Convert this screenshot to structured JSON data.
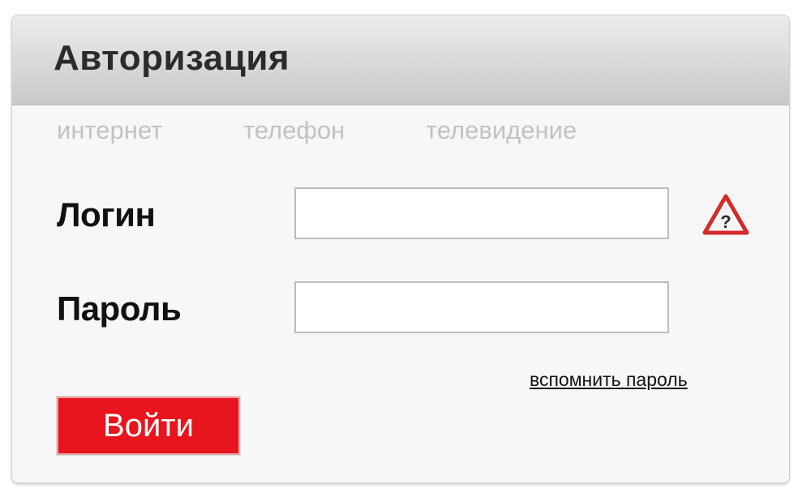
{
  "header": {
    "title": "Авторизация"
  },
  "tabs": [
    {
      "label": "интернет"
    },
    {
      "label": "телефон"
    },
    {
      "label": "телевидение"
    }
  ],
  "form": {
    "login_label": "Логин",
    "login_value": "",
    "password_label": "Пароль",
    "password_value": "",
    "forgot_label": "вспомнить пароль",
    "submit_label": "Войти",
    "help_icon": "warning-question-icon"
  },
  "colors": {
    "accent": "#e8141e",
    "warning": "#d42b2b"
  }
}
